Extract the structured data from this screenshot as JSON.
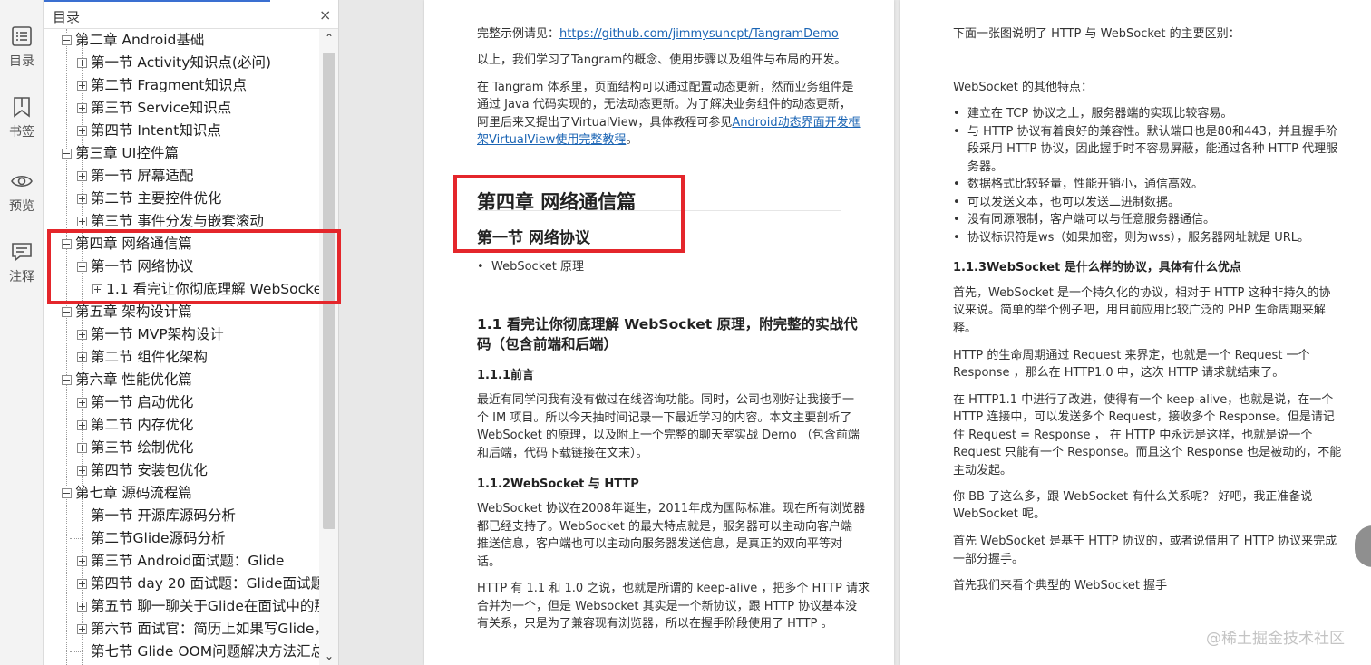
{
  "rail": {
    "toc_label": "目录",
    "bookmark_label": "书签",
    "preview_label": "预览",
    "annotation_label": "注释"
  },
  "toc": {
    "title": "目录",
    "close": "×",
    "items": [
      {
        "label": "第二章 Android基础",
        "level": 0,
        "toggle": "minus"
      },
      {
        "label": "第一节 Activity知识点(必问)",
        "level": 1,
        "toggle": "plus"
      },
      {
        "label": "第二节 Fragment知识点",
        "level": 1,
        "toggle": "plus"
      },
      {
        "label": "第三节 Service知识点",
        "level": 1,
        "toggle": "plus"
      },
      {
        "label": "第四节 Intent知识点",
        "level": 1,
        "toggle": "plus"
      },
      {
        "label": "第三章 UI控件篇",
        "level": 0,
        "toggle": "minus"
      },
      {
        "label": "第一节 屏幕适配",
        "level": 1,
        "toggle": "plus"
      },
      {
        "label": "第二节 主要控件优化",
        "level": 1,
        "toggle": "plus"
      },
      {
        "label": "第三节 事件分发与嵌套滚动",
        "level": 1,
        "toggle": "plus"
      },
      {
        "label": "第四章 网络通信篇",
        "level": 0,
        "toggle": "minus"
      },
      {
        "label": "第一节 网络协议",
        "level": 1,
        "toggle": "minus"
      },
      {
        "label": "1.1 看完让你彻底理解 WebSocket",
        "level": 2,
        "toggle": "plus"
      },
      {
        "label": "第五章 架构设计篇",
        "level": 0,
        "toggle": "minus"
      },
      {
        "label": "第一节 MVP架构设计",
        "level": 1,
        "toggle": "plus"
      },
      {
        "label": "第二节 组件化架构",
        "level": 1,
        "toggle": "plus"
      },
      {
        "label": "第六章 性能优化篇",
        "level": 0,
        "toggle": "minus"
      },
      {
        "label": "第一节 启动优化",
        "level": 1,
        "toggle": "plus"
      },
      {
        "label": "第二节 内存优化",
        "level": 1,
        "toggle": "plus"
      },
      {
        "label": "第三节 绘制优化",
        "level": 1,
        "toggle": "plus"
      },
      {
        "label": "第四节 安装包优化",
        "level": 1,
        "toggle": "plus"
      },
      {
        "label": "第七章 源码流程篇",
        "level": 0,
        "toggle": "minus"
      },
      {
        "label": "第一节 开源库源码分析",
        "level": 1,
        "toggle": "none"
      },
      {
        "label": "第二节Glide源码分析",
        "level": 1,
        "toggle": "none"
      },
      {
        "label": "第三节 Android面试题：Glide",
        "level": 1,
        "toggle": "plus"
      },
      {
        "label": "第四节 day 20 面试题：Glide面试题",
        "level": 1,
        "toggle": "plus"
      },
      {
        "label": "第五节 聊一聊关于Glide在面试中的那",
        "level": 1,
        "toggle": "plus"
      },
      {
        "label": "第六节 面试官：简历上如果写Glide，",
        "level": 1,
        "toggle": "plus"
      },
      {
        "label": "第七节 Glide OOM问题解决方法汇总",
        "level": 1,
        "toggle": "none"
      }
    ],
    "scroll_up": "⌃",
    "scroll_down": "⌄"
  },
  "page1": {
    "p_example_prefix": "完整示例请见：",
    "p_example_link": "https://github.com/jimmysuncpt/TangramDemo",
    "p_summary": "以上，我们学习了Tangram的概念、使用步骤以及组件与布局的开发。",
    "p_tangram_l1": "在 Tangram 体系里，页面结构可以通过配置动态更新，然而业务组件是",
    "p_tangram_l2": "通过 Java 代码实现的，无法动态更新。为了解决业务组件的动态更新，",
    "p_tangram_l3_text": "阿里后来又提出了VirtualView，具体教程可参见",
    "p_tangram_l3_link": "Android动态界面开发框",
    "p_tangram_l4_link": "架VirtualView使用完整教程",
    "p_tangram_l4_tail": "。",
    "chapter_title": "第四章 网络通信篇",
    "section_title": "第一节 网络协议",
    "bullet_ws": "WebSocket 原理",
    "h_11_l1": "1.1 看完让你彻底理解 WebSocket 原理，附完整的实战代",
    "h_11_l2": "码（包含前端和后端）",
    "h_111": "1.1.1前言",
    "p_intro_l1": "最近有同学问我有没有做过在线咨询功能。同时，公司也刚好让我接手一",
    "p_intro_l2": "个 IM 项目。所以今天抽时间记录一下最近学习的内容。本文主要剖析了",
    "p_intro_l3": "WebSocket 的原理，以及附上一个完整的聊天室实战 Demo （包含前端",
    "p_intro_l4": "和后端，代码下载链接在文末）。",
    "h_112": "1.1.2WebSocket 与 HTTP",
    "p_ws_l1": "WebSocket 协议在2008年诞生，2011年成为国际标准。现在所有浏览器",
    "p_ws_l2": "都已经支持了。WebSocket 的最大特点就是，服务器可以主动向客户端",
    "p_ws_l3": "推送信息，客户端也可以主动向服务器发送信息，是真正的双向平等对",
    "p_ws_l4": "话。",
    "p_http_l1": "HTTP 有 1.1 和 1.0 之说，也就是所谓的 keep-alive ，把多个 HTTP 请求",
    "p_http_l2": "合并为一个，但是 Websocket 其实是一个新协议，跟 HTTP 协议基本没",
    "p_http_l3": "有关系，只是为了兼容现有浏览器，所以在握手阶段使用了 HTTP 。"
  },
  "page2": {
    "p_diff": "下面一张图说明了 HTTP 与 WebSocket 的主要区别：",
    "p_features": "WebSocket 的其他特点：",
    "bullets": [
      [
        "建立在 TCP 协议之上，服务器端的实现比较容易。"
      ],
      [
        "与 HTTP 协议有着良好的兼容性。默认端口也是80和443，并且握手阶",
        "段采用 HTTP 协议，因此握手时不容易屏蔽，能通过各种 HTTP 代理服",
        "务器。"
      ],
      [
        "数据格式比较轻量，性能开销小，通信高效。"
      ],
      [
        "可以发送文本，也可以发送二进制数据。"
      ],
      [
        "没有同源限制，客户端可以与任意服务器通信。"
      ],
      [
        "协议标识符是ws（如果加密，则为wss），服务器网址就是 URL。"
      ]
    ],
    "h_113": "1.1.3WebSocket 是什么样的协议，具体有什么优点",
    "p_first_l1": "首先，WebSocket 是一个持久化的协议，相对于 HTTP 这种非持久的协",
    "p_first_l2": "议来说。简单的举个例子吧，用目前应用比较广泛的 PHP 生命周期来解",
    "p_first_l3": "释。",
    "p_life_l1": "HTTP 的生命周期通过 Request 来界定，也就是一个 Request 一个",
    "p_life_l2": "Response ，那么在 HTTP1.0 中，这次 HTTP 请求就结束了。",
    "p_11_l1": "在 HTTP1.1 中进行了改进，使得有一个 keep-alive，也就是说，在一个",
    "p_11_l2": "HTTP 连接中，可以发送多个 Request，接收多个 Response。但是请记",
    "p_11_l3": "住 Request = Response ， 在 HTTP 中永远是这样，也就是说一个",
    "p_11_l4": "Request 只能有一个 Response。而且这个 Response 也是被动的，不能",
    "p_11_l5": "主动发起。",
    "p_bb_l1": "你 BB 了这么多，跟 WebSocket 有什么关系呢？ 好吧，我正准备说",
    "p_bb_l2": "WebSocket 呢。",
    "p_based_l1": "首先 WebSocket 是基于 HTTP 协议的，或者说借用了 HTTP 协议来完成",
    "p_based_l2": "一部分握手。",
    "p_typical": "首先我们来看个典型的 WebSocket 握手"
  },
  "watermark": "@稀土掘金技术社区",
  "colors": {
    "accent": "#3a6fd1",
    "highlight": "#e4262b",
    "link": "#1a64b4"
  }
}
